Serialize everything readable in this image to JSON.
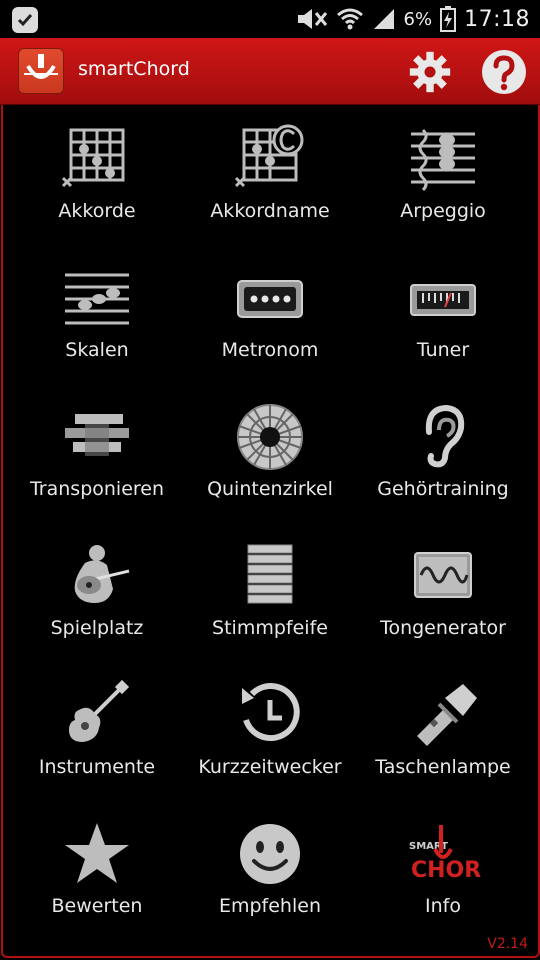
{
  "statusbar": {
    "battery": "6%",
    "time": "17:18"
  },
  "appbar": {
    "title": "smartChord"
  },
  "menu": [
    {
      "label": "Akkorde",
      "icon": "chord-diagram-icon"
    },
    {
      "label": "Akkordname",
      "icon": "chord-name-icon"
    },
    {
      "label": "Arpeggio",
      "icon": "arpeggio-icon"
    },
    {
      "label": "Skalen",
      "icon": "scales-icon"
    },
    {
      "label": "Metronom",
      "icon": "metronome-icon"
    },
    {
      "label": "Tuner",
      "icon": "tuner-icon"
    },
    {
      "label": "Transponieren",
      "icon": "transpose-icon"
    },
    {
      "label": "Quintenzirkel",
      "icon": "circle-of-fifths-icon"
    },
    {
      "label": "Gehörtraining",
      "icon": "ear-icon"
    },
    {
      "label": "Spielplatz",
      "icon": "guitar-player-icon"
    },
    {
      "label": "Stimmpfeife",
      "icon": "pitch-pipe-icon"
    },
    {
      "label": "Tongenerator",
      "icon": "tone-generator-icon"
    },
    {
      "label": "Instrumente",
      "icon": "guitar-icon"
    },
    {
      "label": "Kurzzeitwecker",
      "icon": "timer-icon"
    },
    {
      "label": "Taschenlampe",
      "icon": "flashlight-icon"
    },
    {
      "label": "Bewerten",
      "icon": "star-icon"
    },
    {
      "label": "Empfehlen",
      "icon": "smiley-icon"
    },
    {
      "label": "Info",
      "icon": "smartchord-logo-icon"
    }
  ],
  "version": "V2.14",
  "colors": {
    "appbar": "#c01414",
    "accent": "#c01a1a",
    "icon": "#b8b8b8"
  }
}
